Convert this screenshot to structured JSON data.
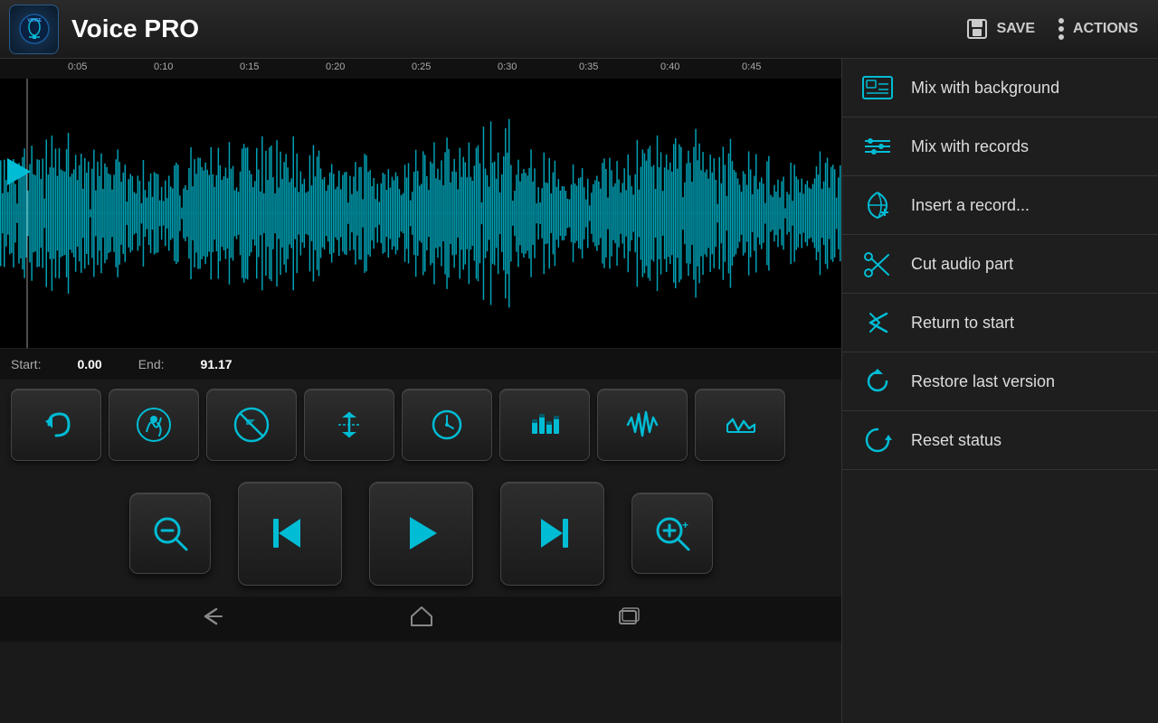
{
  "app": {
    "logo_text": "VOICE\nPRO",
    "title": "Voice PRO"
  },
  "topbar": {
    "save_label": "SAVE",
    "actions_label": "ACTIONS"
  },
  "timeline": {
    "ticks": [
      "0:05",
      "0:10",
      "0:15",
      "0:20",
      "0:25",
      "0:30",
      "0:35",
      "0:40",
      "0:45"
    ]
  },
  "status": {
    "start_label": "Start:",
    "start_value": "0.00",
    "end_label": "End:",
    "end_value": "91.17"
  },
  "menu": {
    "items": [
      {
        "id": "mix-bg",
        "label": "Mix with background",
        "icon": "⊞"
      },
      {
        "id": "mix-rec",
        "label": "Mix with records",
        "icon": "⊟"
      },
      {
        "id": "insert",
        "label": "Insert a record...",
        "icon": "↺"
      },
      {
        "id": "cut",
        "label": "Cut audio part",
        "icon": "✂"
      },
      {
        "id": "return",
        "label": "Return to start",
        "icon": "⤧"
      },
      {
        "id": "restore",
        "label": "Restore last version",
        "icon": "↺"
      },
      {
        "id": "reset",
        "label": "Reset status",
        "icon": "↺"
      }
    ]
  },
  "toolbar": {
    "buttons": [
      {
        "id": "undo",
        "icon": "↩",
        "label": "undo"
      },
      {
        "id": "noise-reduce",
        "icon": "🏃",
        "label": "noise reduce"
      },
      {
        "id": "mute",
        "icon": "🚫",
        "label": "mute"
      },
      {
        "id": "normalize",
        "icon": "↕",
        "label": "normalize"
      },
      {
        "id": "time",
        "icon": "⏱",
        "label": "time"
      },
      {
        "id": "equalizer",
        "icon": "▦",
        "label": "equalizer"
      },
      {
        "id": "waveform",
        "icon": "〜",
        "label": "waveform"
      },
      {
        "id": "effects",
        "icon": "⎍",
        "label": "effects"
      }
    ]
  },
  "transport": {
    "buttons": [
      {
        "id": "zoom-out",
        "icon": "🔍-",
        "label": "zoom out"
      },
      {
        "id": "prev",
        "icon": "⏮",
        "label": "previous"
      },
      {
        "id": "play",
        "icon": "▶",
        "label": "play"
      },
      {
        "id": "next",
        "icon": "⏭",
        "label": "next"
      },
      {
        "id": "zoom-in",
        "icon": "🔍+",
        "label": "zoom in"
      }
    ]
  },
  "android_nav": {
    "back_icon": "←",
    "home_icon": "⌂",
    "recents_icon": "▭"
  }
}
